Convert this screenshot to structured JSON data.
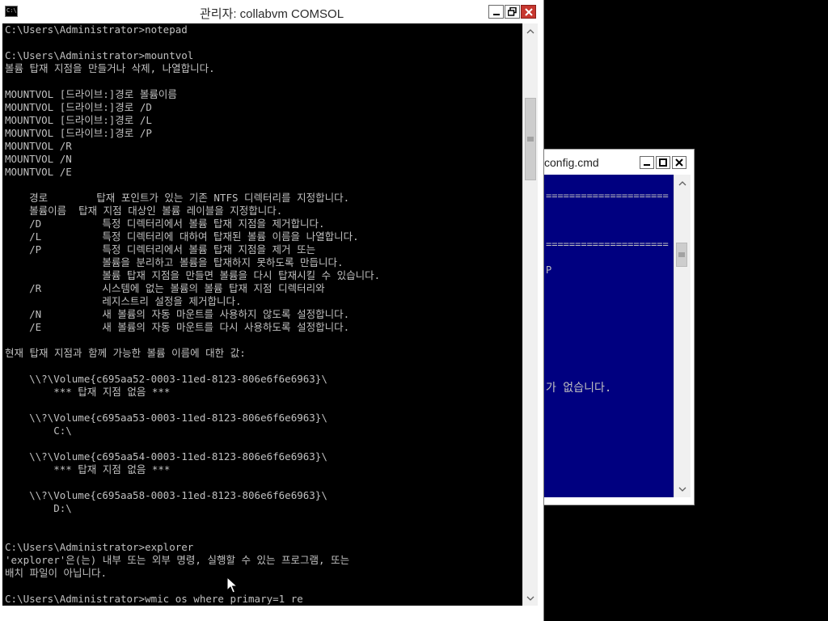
{
  "back_window": {
    "title": "config.cmd",
    "lines": [
      "=====================",
      "=====================",
      "P",
      "가 없습니다."
    ]
  },
  "main_window": {
    "title": "관리자: collabvm COMSOL",
    "console_lines": [
      "C:\\Users\\Administrator>notepad",
      "",
      "C:\\Users\\Administrator>mountvol",
      "볼륨 탑재 지점을 만들거나 삭제, 나열합니다.",
      "",
      "MOUNTVOL [드라이브:]경로 볼륨이름",
      "MOUNTVOL [드라이브:]경로 /D",
      "MOUNTVOL [드라이브:]경로 /L",
      "MOUNTVOL [드라이브:]경로 /P",
      "MOUNTVOL /R",
      "MOUNTVOL /N",
      "MOUNTVOL /E",
      "",
      "    경로        탑재 포인트가 있는 기존 NTFS 디렉터리를 지정합니다.",
      "    볼륨이름  탑재 지점 대상인 볼륨 레이블을 지정합니다.",
      "    /D          특정 디렉터리에서 볼륨 탑재 지점을 제거합니다.",
      "    /L          특정 디렉터리에 대하여 탑재된 볼륨 이름을 나열합니다.",
      "    /P          특정 디렉터리에서 볼륨 탑재 지점을 제거 또는",
      "                볼륨을 분리하고 볼륨을 탑재하지 못하도록 만듭니다.",
      "                볼륨 탑재 지점을 만들면 볼륨을 다시 탑재시킬 수 있습니다.",
      "    /R          시스템에 없는 볼륨의 볼륨 탑재 지점 디렉터리와",
      "                레지스트리 설정을 제거합니다.",
      "    /N          새 볼륨의 자동 마운트를 사용하지 않도록 설정합니다.",
      "    /E          새 볼륨의 자동 마운트를 다시 사용하도록 설정합니다.",
      "",
      "현재 탑재 지점과 함께 가능한 볼륨 이름에 대한 값:",
      "",
      "    \\\\?\\Volume{c695aa52-0003-11ed-8123-806e6f6e6963}\\",
      "        *** 탑재 지점 없음 ***",
      "",
      "    \\\\?\\Volume{c695aa53-0003-11ed-8123-806e6f6e6963}\\",
      "        C:\\",
      "",
      "    \\\\?\\Volume{c695aa54-0003-11ed-8123-806e6f6e6963}\\",
      "        *** 탑재 지점 없음 ***",
      "",
      "    \\\\?\\Volume{c695aa58-0003-11ed-8123-806e6f6e6963}\\",
      "        D:\\",
      "",
      "",
      "C:\\Users\\Administrator>explorer",
      "'explorer'은(는) 내부 또는 외부 명령, 실행할 수 있는 프로그램, 또는",
      "배치 파일이 아닙니다.",
      "",
      "C:\\Users\\Administrator>wmic os where primary=1 re"
    ]
  }
}
